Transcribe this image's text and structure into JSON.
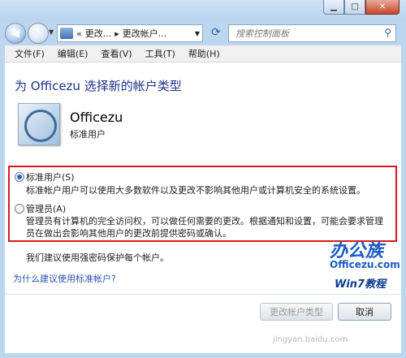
{
  "window": {
    "controls": {
      "minimize": "▁",
      "maximize": "□",
      "close": "✕"
    }
  },
  "nav": {
    "breadcrumb": [
      "«",
      "更改...",
      "▸",
      "更改帐户..."
    ],
    "search_placeholder": "搜索控制面板",
    "icons": [
      "back-arrow-icon",
      "forward-arrow-icon",
      "refresh-icon",
      "search-icon"
    ]
  },
  "menu": [
    "文件(F)",
    "编辑(E)",
    "查看(V)",
    "工具(T)",
    "帮助(H)"
  ],
  "page": {
    "heading": "为 Officezu 选择新的帐户类型",
    "user_name": "Officezu",
    "user_type": "标准用户",
    "options": [
      {
        "label": "标准用户(S)",
        "selected": true,
        "desc": "标准帐户用户可以使用大多数软件以及更改不影响其他用户或计算机安全的系统设置。"
      },
      {
        "label": "管理员(A)",
        "selected": false,
        "desc": "管理员有计算机的完全访问权，可以做任何需要的更改。根据通知和设置，可能会要求管理员在做出会影响其他用户的更改前提供密码或确认。"
      }
    ],
    "recommend": "我们建议使用强密码保护每个帐户。",
    "link": "为什么建议使用标准帐户?",
    "change_button": "更改帐户类型",
    "cancel_button": "取消"
  },
  "watermark": {
    "logo_top": "办公族",
    "logo_mid": "Officezu.com",
    "logo_bottom": "Win7教程",
    "baidu": "jingyan.baidu.com"
  },
  "colors": {
    "heading": "#1e3287",
    "link": "#2a54b5",
    "highlight_box": "#d7191c"
  }
}
